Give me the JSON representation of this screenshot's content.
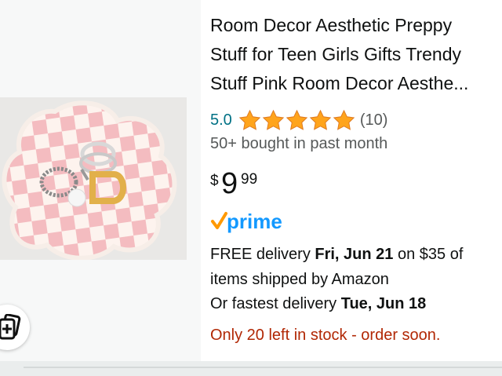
{
  "product": {
    "title_lines": [
      "Room Decor Aesthetic Preppy",
      "Stuff for Teen Girls Gifts Trendy",
      "Stuff Pink Room Decor Aesthe..."
    ],
    "rating": {
      "value": "5.0",
      "stars": 5,
      "out_of": 5,
      "count": "(10)"
    },
    "bought": "50+ bought in past month",
    "price": {
      "symbol": "$",
      "whole": "9",
      "fraction": "99"
    },
    "prime_label": "prime",
    "delivery": {
      "prefix": "FREE delivery ",
      "date": "Fri, Jun 21",
      "suffix": " on $35 of",
      "line2": "items shipped by Amazon"
    },
    "fastest": {
      "prefix": "Or fastest delivery ",
      "date": "Tue, Jun 18"
    },
    "stock": "Only 20 left in stock - order soon."
  },
  "image": {
    "description_icon": "flower-tray-with-rings",
    "alt": ""
  },
  "icons": {
    "action": "add-to-list-icon",
    "prime_check": "prime-check-icon"
  },
  "colors": {
    "link": "#007185",
    "star": "#ffa41c",
    "stock": "#b12704",
    "prime": "#1399ff",
    "prime_check": "#ff9900",
    "muted": "#565959"
  }
}
